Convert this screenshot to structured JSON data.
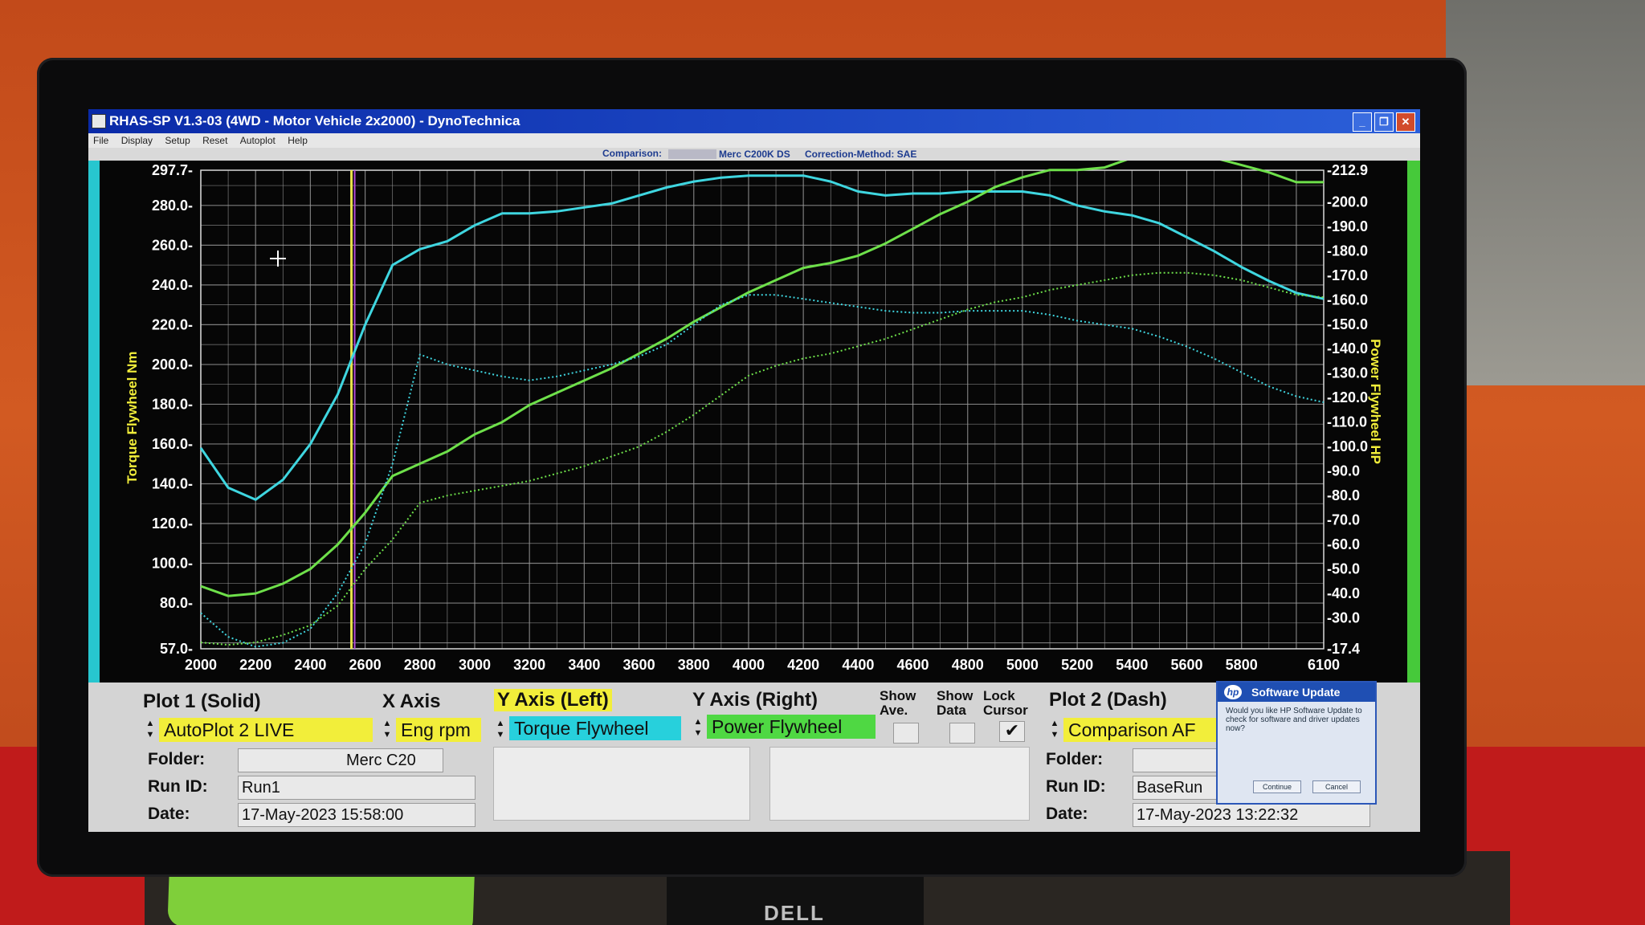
{
  "window": {
    "title": "RHAS-SP V1.3-03  (4WD - Motor Vehicle 2x2000) - DynoTechnica",
    "minimize": "_",
    "restore": "❐",
    "close": "✕"
  },
  "menu": [
    "File",
    "Display",
    "Setup",
    "Reset",
    "Autoplot",
    "Help"
  ],
  "infobar": {
    "comparison_label": "Comparison:",
    "run_name": "Merc C200K DS",
    "correction": "Correction-Method: SAE"
  },
  "chart_data": {
    "type": "line",
    "x_tick_labels": [
      "2000",
      "2200",
      "2400",
      "2600",
      "2800",
      "3000",
      "3200",
      "3400",
      "3600",
      "3800",
      "4000",
      "4200",
      "4400",
      "4600",
      "4800",
      "5000",
      "5200",
      "5400",
      "5600",
      "5800",
      "6100"
    ],
    "y_left_tick_labels": [
      "297.7-",
      "280.0-",
      "260.0-",
      "240.0-",
      "220.0-",
      "200.0-",
      "180.0-",
      "160.0-",
      "140.0-",
      "120.0-",
      "100.0-",
      "80.0-",
      "57.0-"
    ],
    "y_right_tick_labels": [
      "-212.9",
      "-200.0",
      "-190.0",
      "-180.0",
      "-170.0",
      "-160.0",
      "-150.0",
      "-140.0",
      "-130.0",
      "-120.0",
      "-110.0",
      "-100.0",
      "-90.0",
      "-80.0",
      "-70.0",
      "-60.0",
      "-50.0",
      "-40.0",
      "-30.0",
      "-17.4"
    ],
    "ylabel_left": "Torque Flywheel Nm",
    "ylabel_right": "Power Flywheel HP",
    "xlim": [
      2000,
      6100
    ],
    "ylim_left": [
      57.0,
      297.7
    ],
    "ylim_right": [
      17.4,
      212.9
    ],
    "grid": true,
    "cursor_rpm": 2550,
    "series": [
      {
        "name": "Torque Flywheel (Plot 1, solid)",
        "axis": "left",
        "style": "solid",
        "color": "#3fd6e0",
        "x": [
          2000,
          2100,
          2200,
          2300,
          2400,
          2500,
          2600,
          2700,
          2800,
          2900,
          3000,
          3100,
          3200,
          3300,
          3400,
          3500,
          3600,
          3700,
          3800,
          3900,
          4000,
          4100,
          4200,
          4300,
          4400,
          4500,
          4600,
          4700,
          4800,
          4900,
          5000,
          5100,
          5200,
          5300,
          5400,
          5500,
          5600,
          5700,
          5800,
          5900,
          6000,
          6100
        ],
        "y": [
          158,
          138,
          132,
          142,
          160,
          185,
          220,
          250,
          258,
          262,
          270,
          276,
          276,
          277,
          279,
          281,
          285,
          289,
          292,
          294,
          295,
          295,
          295,
          292,
          287,
          285,
          286,
          286,
          287,
          287,
          287,
          285,
          280,
          277,
          275,
          271,
          264,
          257,
          249,
          242,
          236,
          233
        ]
      },
      {
        "name": "Power Flywheel (Plot 1, solid)",
        "axis": "right",
        "style": "solid",
        "color": "#6ee04a",
        "x": [
          2000,
          2100,
          2200,
          2300,
          2400,
          2500,
          2600,
          2700,
          2800,
          2900,
          3000,
          3100,
          3200,
          3300,
          3400,
          3500,
          3600,
          3700,
          3800,
          3900,
          4000,
          4100,
          4200,
          4300,
          4400,
          4500,
          4600,
          4700,
          4800,
          4900,
          5000,
          5100,
          5200,
          5300,
          5400,
          5500,
          5600,
          5700,
          5800,
          5900,
          6000,
          6100
        ],
        "y": [
          43,
          39,
          40,
          44,
          50,
          60,
          73,
          88,
          93,
          98,
          105,
          110,
          117,
          122,
          127,
          132,
          138,
          144,
          151,
          157,
          163,
          168,
          173,
          175,
          178,
          183,
          189,
          195,
          200,
          206,
          210,
          213,
          213,
          214,
          218,
          220,
          219,
          218,
          215,
          212,
          208,
          208
        ]
      },
      {
        "name": "Torque Flywheel (Plot 2, dash)",
        "axis": "left",
        "style": "dotted",
        "color": "#3fd6e0",
        "x": [
          2000,
          2100,
          2200,
          2300,
          2400,
          2500,
          2600,
          2700,
          2800,
          2900,
          3000,
          3100,
          3200,
          3300,
          3400,
          3500,
          3600,
          3700,
          3800,
          3900,
          4000,
          4100,
          4200,
          4300,
          4400,
          4500,
          4600,
          4700,
          4800,
          4900,
          5000,
          5100,
          5200,
          5300,
          5400,
          5500,
          5600,
          5700,
          5800,
          5900,
          6000,
          6100
        ],
        "y": [
          75,
          63,
          58,
          60,
          67,
          85,
          110,
          150,
          205,
          200,
          197,
          194,
          192,
          194,
          197,
          200,
          204,
          210,
          220,
          230,
          235,
          235,
          233,
          231,
          229,
          227,
          226,
          226,
          227,
          227,
          227,
          225,
          222,
          220,
          218,
          214,
          209,
          203,
          196,
          189,
          184,
          181
        ]
      },
      {
        "name": "Power Flywheel (Plot 2, dash)",
        "axis": "right",
        "style": "dotted",
        "color": "#6ee04a",
        "x": [
          2000,
          2100,
          2200,
          2300,
          2400,
          2500,
          2600,
          2700,
          2800,
          2900,
          3000,
          3100,
          3200,
          3300,
          3400,
          3500,
          3600,
          3700,
          3800,
          3900,
          4000,
          4100,
          4200,
          4300,
          4400,
          4500,
          4600,
          4700,
          4800,
          4900,
          5000,
          5100,
          5200,
          5300,
          5400,
          5500,
          5600,
          5700,
          5800,
          5900,
          6000,
          6100
        ],
        "y": [
          20,
          19,
          20,
          23,
          27,
          35,
          50,
          62,
          77,
          80,
          82,
          84,
          86,
          89,
          92,
          96,
          100,
          106,
          113,
          121,
          129,
          133,
          136,
          138,
          141,
          144,
          148,
          152,
          156,
          159,
          161,
          164,
          166,
          168,
          170,
          171,
          171,
          170,
          168,
          165,
          162,
          161
        ]
      }
    ]
  },
  "panel": {
    "plot1_header": "Plot 1 (Solid)",
    "xaxis_header": "X Axis",
    "yleft_header": "Y Axis (Left)",
    "yright_header": "Y Axis (Right)",
    "show_ave_header": "Show Ave.",
    "show_data_header": "Show Data",
    "lock_cursor_header": "Lock Cursor",
    "plot2_header": "Plot 2 (Dash)",
    "plot1_select": "AutoPlot 2 LIVE",
    "xaxis_select": "Eng rpm",
    "yleft_select": "Torque Flywheel",
    "yright_select": "Power Flywheel",
    "plot2_select": "Comparison AF",
    "folder_label": "Folder:",
    "runid_label": "Run ID:",
    "date_label": "Date:",
    "plot1_folder": "Merc C20",
    "plot1_runid": "Run1",
    "plot1_date": "17-May-2023  15:58:00",
    "plot2_folder": "",
    "plot2_runid": "BaseRun",
    "plot2_date": "17-May-2023  13:22:32",
    "check_mark": "✔"
  },
  "software_update": {
    "logo": "hp",
    "title": "Software Update",
    "message": "Would you like HP Software Update to check for software and driver updates now?",
    "continue": "Continue",
    "cancel": "Cancel"
  },
  "monitor_brand": "DELL",
  "colors": {
    "title_bar": "#0a2aa8",
    "chart_bg": "#060606",
    "grid": "#c9c9c9",
    "torque": "#3fd6e0",
    "power": "#6ee04a",
    "cursor_yellow": "#e6e04a",
    "cursor_purple": "#b24ad8",
    "yellow_field": "#f2ee3a",
    "cyan_field": "#27d0dc",
    "green_field": "#4fd843"
  }
}
